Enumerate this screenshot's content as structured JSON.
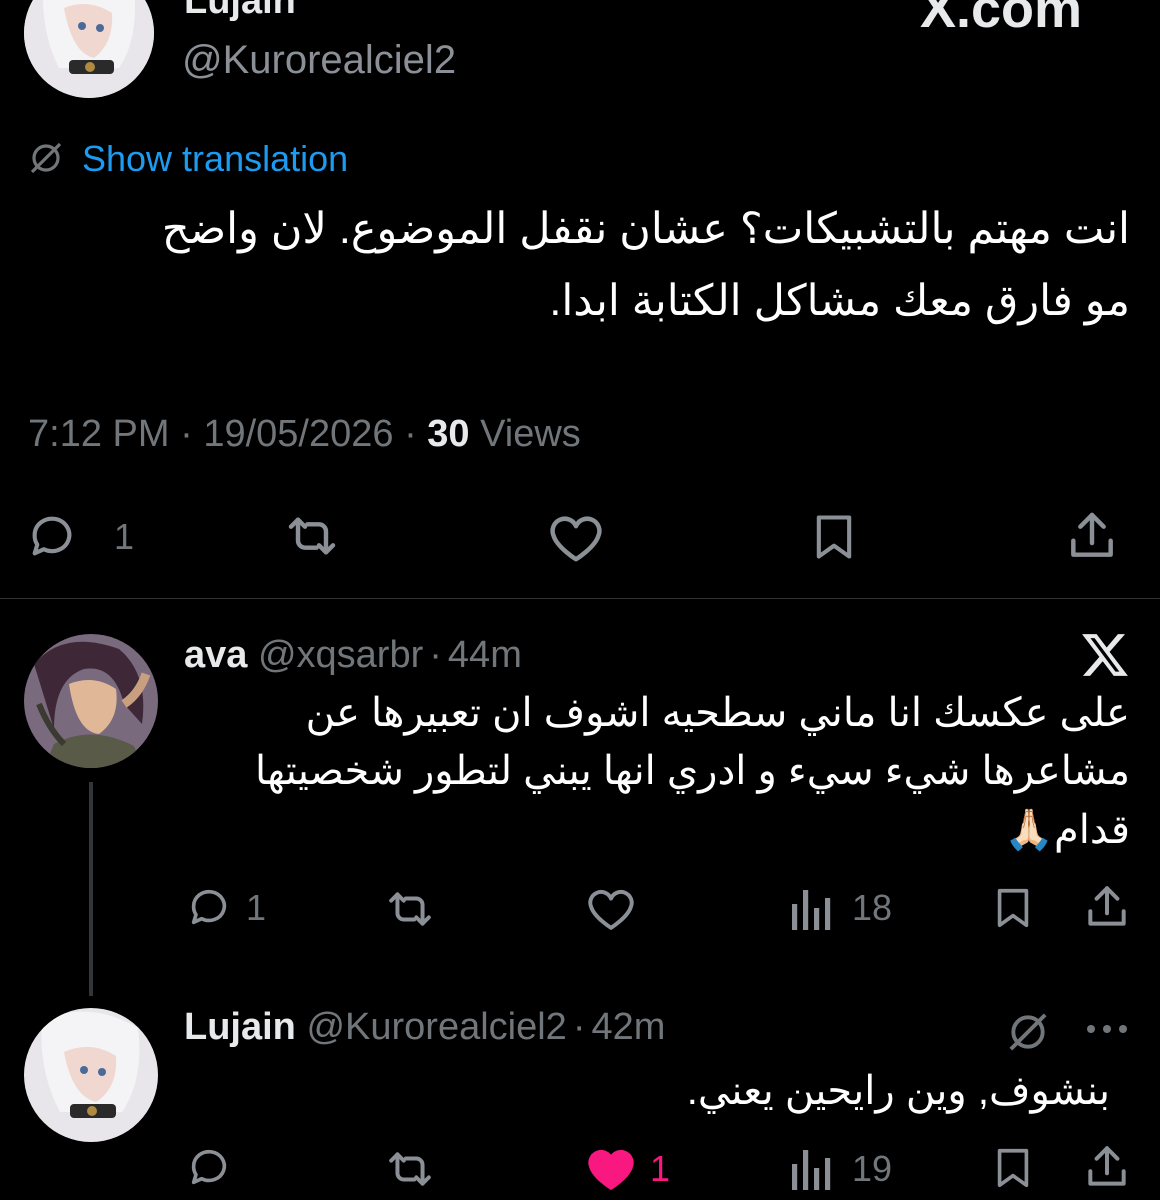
{
  "main_tweet": {
    "display_name": "Lujain",
    "handle": "@Kurorealciel2",
    "watermark": "X.com",
    "translation_label": "Show translation",
    "text_line1": "انت مهتم بالتشبيكات؟ عشان نقفل الموضوع. لان واضح",
    "text_line2": "مو فارق معك مشاكل الكتابة ابدا.",
    "time": "7:12 PM",
    "date": "19/05/2026",
    "sep": "·",
    "views_count": "30",
    "views_label": "Views",
    "actions": {
      "reply_count": "1"
    }
  },
  "reply_1": {
    "display_name": "ava",
    "handle": "@xqsarbr",
    "sep": "·",
    "time": "44m",
    "text_line1": "على عكسك انا ماني سطحيه اشوف ان تعبيرها عن",
    "text_line2": "مشاعرها شيء سيء و ادري انها يبني لتطور شخصيتها",
    "text_line3": "قدام🙏🏻",
    "actions": {
      "reply_count": "1",
      "views_count": "18"
    }
  },
  "reply_2": {
    "display_name": "Lujain",
    "handle": "@Kurorealciel2",
    "sep": "·",
    "time": "42m",
    "text_line1": "بنشوف, وين رايحين يعني.",
    "actions": {
      "like_count": "1",
      "views_count": "19"
    }
  },
  "colors": {
    "background": "#000000",
    "text": "#e7e9ea",
    "muted": "#71767b",
    "link": "#1d9bf0",
    "like": "#f91880",
    "divider": "#2f3336"
  },
  "icons": [
    "translate-icon",
    "reply-icon",
    "retweet-icon",
    "like-icon",
    "bookmark-icon",
    "share-icon",
    "views-icon",
    "x-logo-icon",
    "more-icon"
  ]
}
